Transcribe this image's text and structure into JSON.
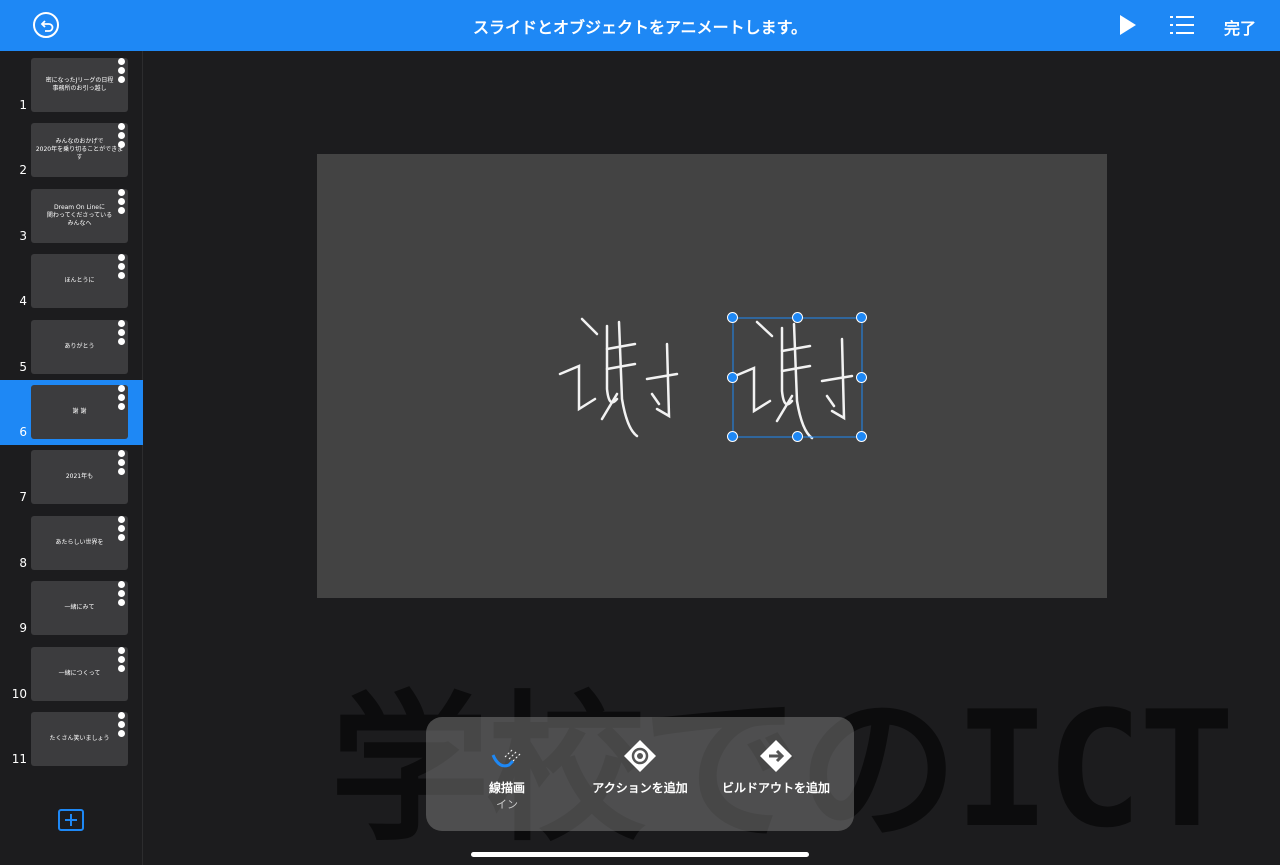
{
  "header": {
    "title": "スライドとオブジェクトをアニメートします。",
    "done_label": "完了",
    "back_icon": "undo-circle-icon",
    "play_icon": "play-icon",
    "list_icon": "list-icon"
  },
  "slides": [
    {
      "num": "1",
      "text": "密になったJリーグの日程\n事務所のお引っ越し"
    },
    {
      "num": "2",
      "text": "みんなのおかげで\n2020年を乗り切ることができます"
    },
    {
      "num": "3",
      "text": "Dream On Lineに\n関わってくださっている\nみんなへ"
    },
    {
      "num": "4",
      "text": "ほんとうに"
    },
    {
      "num": "5",
      "text": "ありがとう"
    },
    {
      "num": "6",
      "text": "謝 謝"
    },
    {
      "num": "7",
      "text": "2021年も"
    },
    {
      "num": "8",
      "text": "あたらしい世界を"
    },
    {
      "num": "9",
      "text": "一緒にみて"
    },
    {
      "num": "10",
      "text": "一緒につくって"
    },
    {
      "num": "11",
      "text": "たくさん笑いましょう"
    }
  ],
  "active_slide": 6,
  "toolbar": {
    "animation_label": "線描画",
    "animation_sub": "イン",
    "action_label": "アクションを追加",
    "buildout_label": "ビルドアウトを追加"
  },
  "watermark": "学校でのICT",
  "colors": {
    "accent": "#1e88f5",
    "background": "#1c1c1e",
    "canvas": "#434343"
  }
}
